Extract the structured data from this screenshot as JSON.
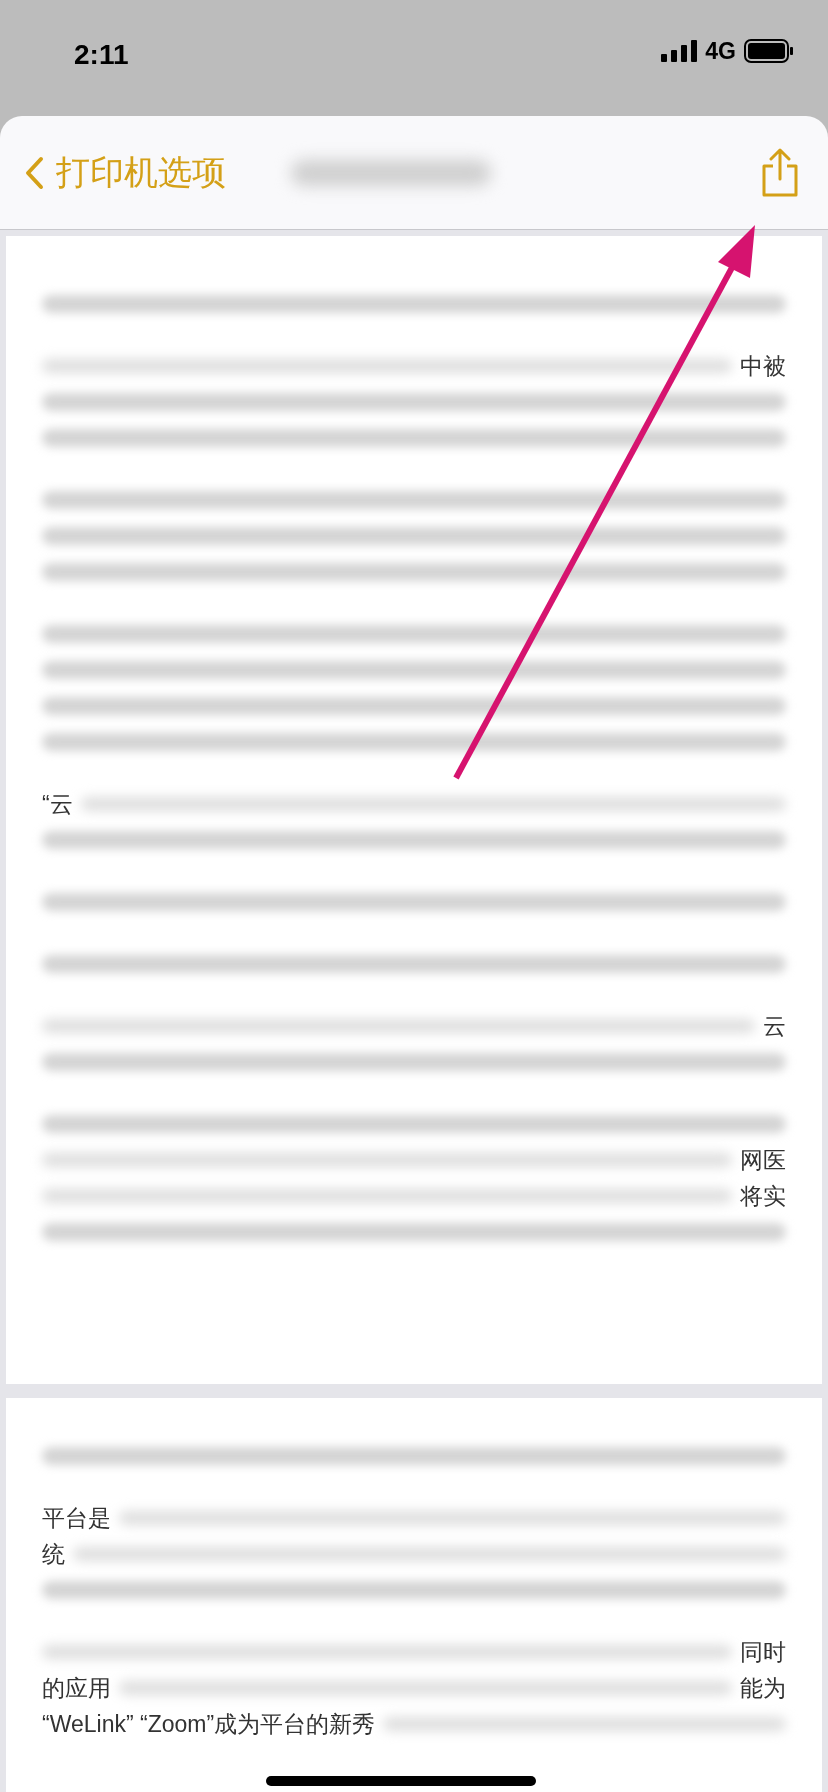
{
  "status_bar": {
    "time": "2:11",
    "network": "4G"
  },
  "nav": {
    "back_label": "打印机选项"
  },
  "pages": [
    [
      [
        {
          "kind": "blur"
        }
      ],
      [
        {
          "kind": "text",
          "end": "中被"
        },
        {
          "kind": "blur"
        },
        {
          "kind": "blur"
        }
      ],
      [
        {
          "kind": "blur"
        },
        {
          "kind": "blur"
        },
        {
          "kind": "blur"
        }
      ],
      [
        {
          "kind": "blur"
        },
        {
          "kind": "blur"
        },
        {
          "kind": "blur"
        },
        {
          "kind": "blur"
        }
      ],
      [
        {
          "kind": "text",
          "start": "“云"
        },
        {
          "kind": "blur"
        }
      ],
      [
        {
          "kind": "blur"
        }
      ],
      [
        {
          "kind": "blur"
        }
      ],
      [
        {
          "kind": "text",
          "end": "云"
        },
        {
          "kind": "blur"
        }
      ],
      [
        {
          "kind": "blur"
        },
        {
          "kind": "text",
          "end": "网医"
        },
        {
          "kind": "text",
          "end": "将实"
        },
        {
          "kind": "blur"
        }
      ]
    ],
    [
      [
        {
          "kind": "blur"
        }
      ],
      [
        {
          "kind": "text",
          "start": "平台是"
        },
        {
          "kind": "text",
          "start": "统"
        },
        {
          "kind": "blur"
        }
      ],
      [
        {
          "kind": "text",
          "end": "同时"
        },
        {
          "kind": "text",
          "start": "的应用",
          "end": "能为"
        },
        {
          "kind": "text",
          "start": "“WeLink” “Zoom”成为平台的新秀"
        }
      ]
    ]
  ]
}
